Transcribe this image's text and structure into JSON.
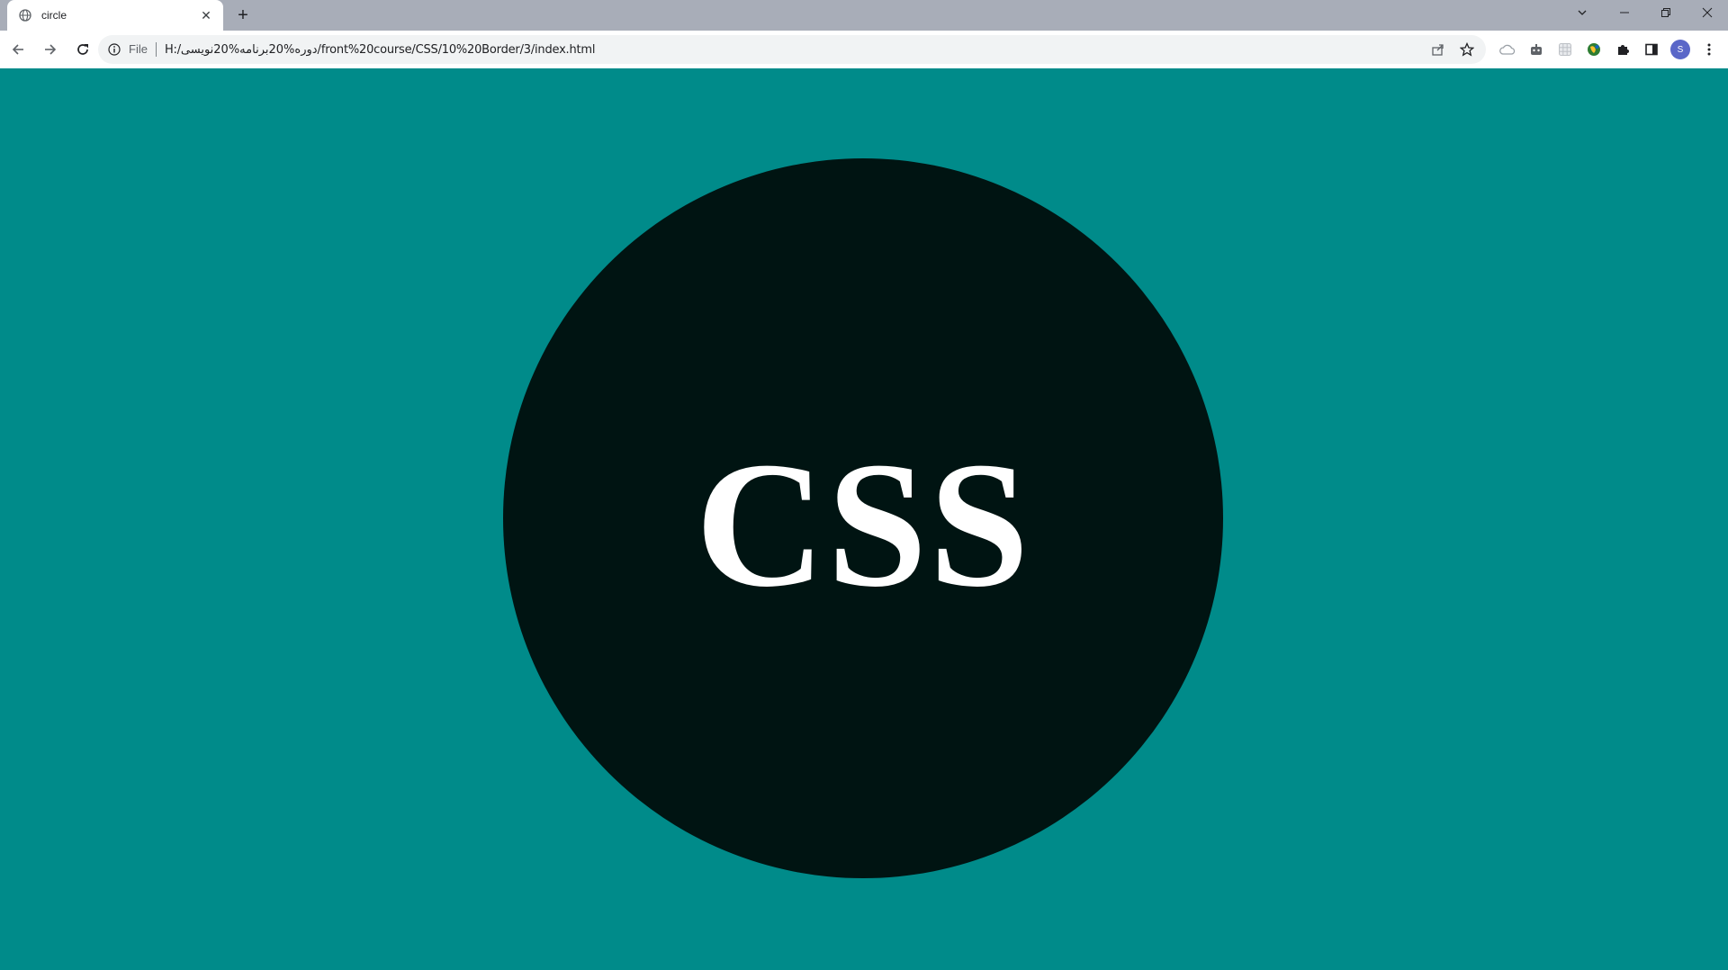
{
  "browser": {
    "tab": {
      "title": "circle",
      "favicon": "globe-icon",
      "close": "✕"
    },
    "new_tab_symbol": "+",
    "window_controls": {
      "tab_search": "chevron-down-icon",
      "minimize": "minimize-icon",
      "restore": "restore-icon",
      "close": "close-icon"
    },
    "toolbar": {
      "back": "back-arrow-icon",
      "forward": "forward-arrow-icon",
      "reload": "reload-icon"
    },
    "omnibox": {
      "info_icon": "info-icon",
      "scheme_label": "File",
      "url": "H:/دوره%20برنامه%20نویسی/front%20course/CSS/10%20Border/3/index.html",
      "share_icon": "share-icon",
      "bookmark_icon": "star-icon"
    },
    "extensions": [
      {
        "name": "cloud-extension-icon"
      },
      {
        "name": "robot-extension-icon"
      },
      {
        "name": "grid-extension-icon"
      },
      {
        "name": "globe-extension-icon"
      },
      {
        "name": "puzzle-extensions-icon"
      },
      {
        "name": "side-panel-icon"
      }
    ],
    "profile_initial": "S",
    "menu_icon": "kebab-menu-icon"
  },
  "page": {
    "background_color": "#008b8a",
    "circle_color": "#001412",
    "circle_text": "CSS",
    "text_color": "#ffffff"
  }
}
